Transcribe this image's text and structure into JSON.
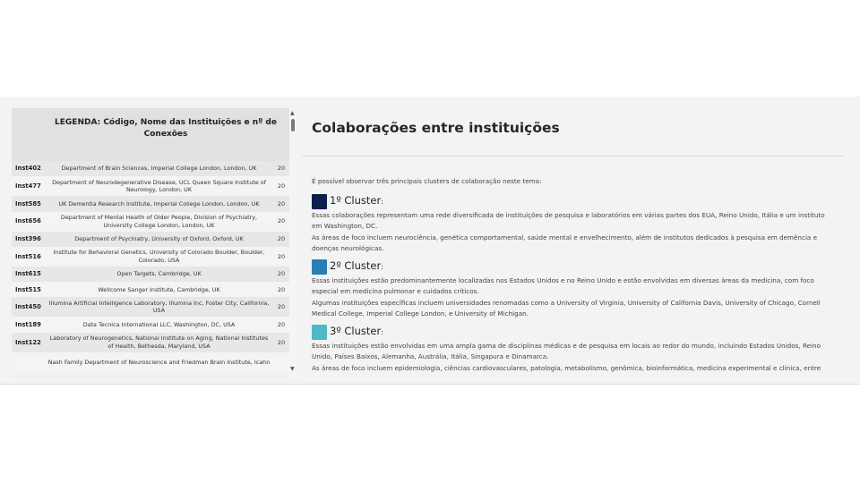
{
  "legend": {
    "header": "LEGENDA: Código, Nome das Instituições e nº de Conexões",
    "rows": [
      {
        "code": "Inst402",
        "name": "Department of Brain Sciences, Imperial College London, London, UK",
        "count": "20"
      },
      {
        "code": "Inst477",
        "name": "Department of Neurodegenerative Disease, UCL Queen Square Institute of Neurology, London, UK",
        "count": "20"
      },
      {
        "code": "Inst585",
        "name": "UK Dementia Research Institute, Imperial College London, London, UK",
        "count": "20"
      },
      {
        "code": "Inst656",
        "name": "Department of Mental Health of Older People, Division of Psychiatry, University College London, London, UK",
        "count": "20"
      },
      {
        "code": "Inst396",
        "name": "Department of Psychiatry, University of Oxford, Oxford, UK",
        "count": "20"
      },
      {
        "code": "Inst516",
        "name": "Institute for Behavioral Genetics, University of Colorado Boulder, Boulder, Colorado, USA",
        "count": "20"
      },
      {
        "code": "Inst615",
        "name": "Open Targets, Cambridge, UK",
        "count": "20"
      },
      {
        "code": "Inst515",
        "name": "Wellcome Sanger Institute, Cambridge, UK",
        "count": "20"
      },
      {
        "code": "Inst450",
        "name": "Illumina Artificial Intelligence Laboratory, Illumina Inc, Foster City, California, USA",
        "count": "20"
      },
      {
        "code": "Inst189",
        "name": "Data Tecnica International LLC, Washington, DC, USA",
        "count": "20"
      },
      {
        "code": "Inst122",
        "name": "Laboratory of Neurogenetics, National Institute on Aging, National Institutes of Health, Bethesda, Maryland, USA",
        "count": "20"
      },
      {
        "code": "",
        "name": "Nash Family Department of Neuroscience and Friedman Brain Institute, Icahn",
        "count": ""
      }
    ]
  },
  "main": {
    "title": "Colaborações entre instituições",
    "intro": "É possível observar três principais clusters de colaboração neste tema:",
    "clusters": [
      {
        "title": "1º Cluster",
        "color": "#0b1f4d",
        "p1": "Essas colaborações representam uma rede diversificada de instituições de pesquisa e laboratórios em várias partes dos EUA, Reino Unido, Itália e um instituto em Washington, DC.",
        "p2": "As áreas de foco incluem neurociência, genética comportamental, saúde mental e envelhecimento, além de institutos dedicados à pesquisa em demência e doenças neurológicas."
      },
      {
        "title": "2º Cluster",
        "color": "#2a7db8",
        "p1": "Essas instituições estão predominantemente localizadas nos Estados Unidos e no Reino Unido e estão envolvidas em diversas áreas da medicina, com foco especial em medicina pulmonar e cuidados críticos.",
        "p2": "Algumas instituições específicas incluem universidades renomadas como a University of Virginia, University of California Davis, University of Chicago, Cornell Medical College, Imperial College London, e University of Michigan."
      },
      {
        "title": "3º Cluster",
        "color": "#4fb8c4",
        "p1": "Essas instituições estão envolvidas em uma ampla gama de disciplinas médicas e de pesquisa em locais ao redor do mundo, incluindo Estados Unidos, Reino Unido, Países Baixos, Alemanha, Austrália, Itália, Singapura e Dinamarca.",
        "p2": "As áreas de foco incluem epidemiologia, ciências cardiovasculares, patologia, metabolismo, genômica, bioinformática, medicina experimental e clínica, entre"
      }
    ]
  },
  "icons": {
    "scroll_up": "triangle-up-icon",
    "scroll_down": "triangle-down-icon"
  }
}
